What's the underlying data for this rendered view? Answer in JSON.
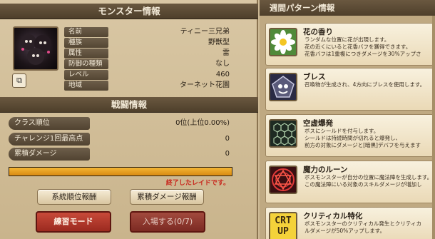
{
  "monster_panel": {
    "title": "モンスター情報",
    "info": [
      {
        "label": "名前",
        "value": "ティニー三兄弟"
      },
      {
        "label": "種族",
        "value": "野獣型"
      },
      {
        "label": "属性",
        "value": "雷"
      },
      {
        "label": "防御の種類",
        "value": "なし"
      },
      {
        "label": "レベル",
        "value": "460"
      },
      {
        "label": "地域",
        "value": "ターネット花園"
      }
    ]
  },
  "battle_panel": {
    "title": "戦闘情報",
    "stats": [
      {
        "label": "クラス順位",
        "value": "0位(上位0.00%)"
      },
      {
        "label": "チャレンジ1回最高点数",
        "value": "0"
      },
      {
        "label": "累積ダメージ",
        "value": "0"
      }
    ],
    "progress_fraction": 1.0,
    "raid_message": "終了したレイドです。",
    "buttons": {
      "class_reward": "系統順位報酬",
      "damage_reward": "累積ダメージ報酬",
      "practice": "練習モード",
      "enter": "入場する(0/7)"
    }
  },
  "weekly_panel": {
    "title": "週間パターン情報",
    "patterns": [
      {
        "name": "花の香り",
        "icon": "flower-icon",
        "desc": [
          "ランダムな位置に花が出現します。",
          "花の近くにいると花香バフを獲得できます。",
          "花香バフは1重複につきダメージを30%アップさ"
        ]
      },
      {
        "name": "ブレス",
        "icon": "breath-icon",
        "desc": [
          "召喚物が生成され、4方向にブレスを使用します。"
        ]
      },
      {
        "name": "空虚爆発",
        "icon": "hexagon-shield-icon",
        "desc": [
          "ボスにシールドを付与します。",
          "シールドは持続時間が切れると爆発し、",
          "前方の対象にダメージと[暗黒]デバフを与えます"
        ]
      },
      {
        "name": "魔力のルーン",
        "icon": "rune-icon",
        "desc": [
          "ボスモンスターが自分の位置に魔法陣を生成します。",
          "この魔法陣にいる対象のスキルダメージが増加し"
        ]
      },
      {
        "name": "クリティカル特化",
        "icon": "crit-icon",
        "icon_text": "CRT UP",
        "desc": [
          "ボスモンスターのクリティカル発生とクリティカ",
          "ルダメージが50%アップします。"
        ]
      }
    ]
  },
  "colors": {
    "header": "#5a4a34",
    "progress": "#e9a020",
    "raid_message": "#c8281e",
    "red_button": "#b0382a"
  }
}
